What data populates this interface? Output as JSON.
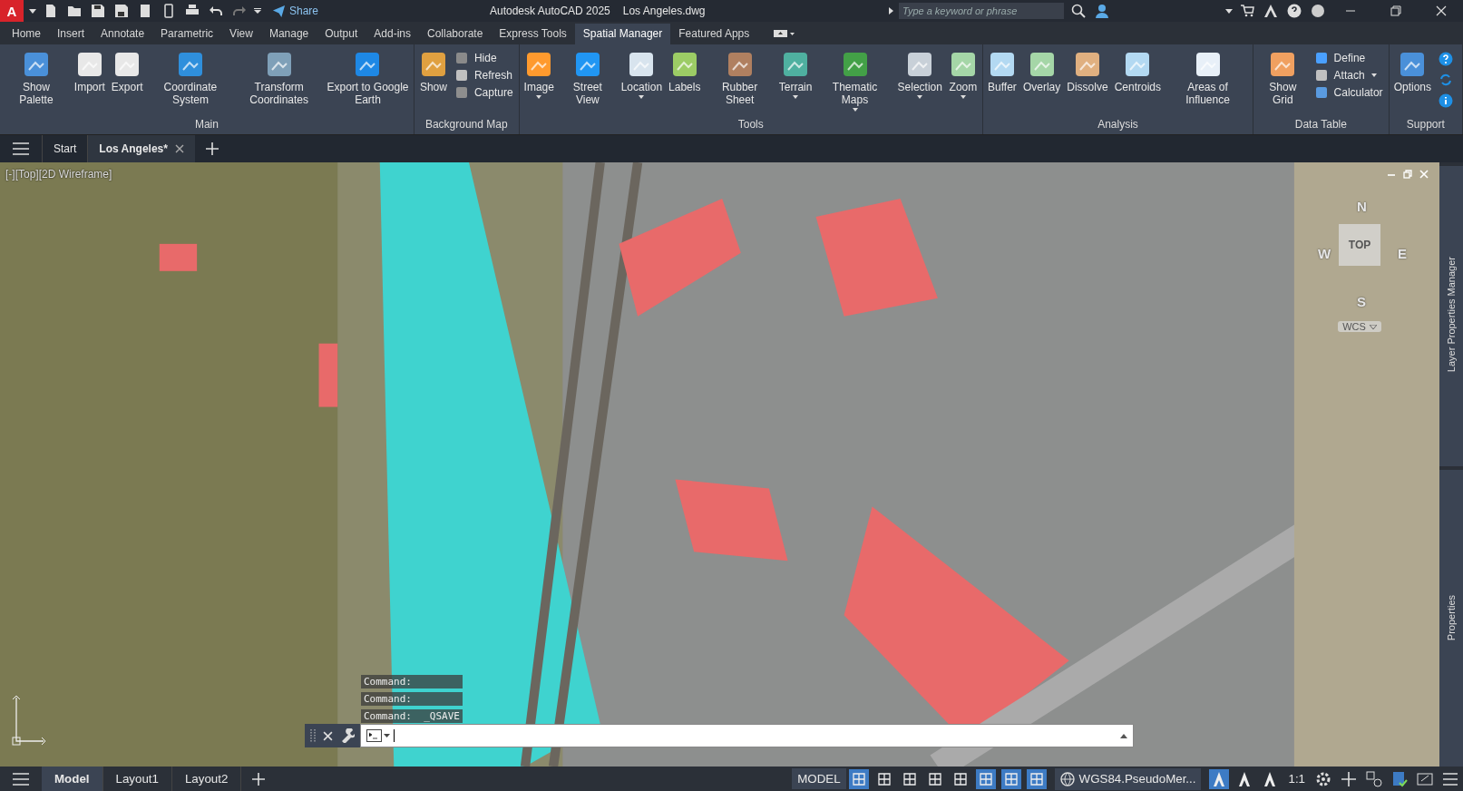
{
  "title_bar": {
    "app_button": "A",
    "share": "Share",
    "app_title": "Autodesk AutoCAD 2025",
    "file_name": "Los Angeles.dwg",
    "search": {
      "placeholder": "Type a keyword or phrase"
    }
  },
  "ribbon_tabs": [
    {
      "label": "Home",
      "selected": false
    },
    {
      "label": "Insert",
      "selected": false
    },
    {
      "label": "Annotate",
      "selected": false
    },
    {
      "label": "Parametric",
      "selected": false
    },
    {
      "label": "View",
      "selected": false
    },
    {
      "label": "Manage",
      "selected": false
    },
    {
      "label": "Output",
      "selected": false
    },
    {
      "label": "Add-ins",
      "selected": false
    },
    {
      "label": "Collaborate",
      "selected": false
    },
    {
      "label": "Express Tools",
      "selected": false
    },
    {
      "label": "Spatial Manager",
      "selected": true
    },
    {
      "label": "Featured Apps",
      "selected": false
    }
  ],
  "ribbon_panels": [
    {
      "title": "Main",
      "items": [
        {
          "kind": "large",
          "label": "Show Palette",
          "dropdown": false
        },
        {
          "kind": "large",
          "label": "Import",
          "dropdown": false
        },
        {
          "kind": "large",
          "label": "Export",
          "dropdown": false
        },
        {
          "kind": "large",
          "label": "Coordinate System",
          "dropdown": false
        },
        {
          "kind": "large",
          "label": "Transform Coordinates",
          "dropdown": false
        },
        {
          "kind": "large",
          "label": "Export to Google Earth",
          "dropdown": false
        }
      ]
    },
    {
      "title": "Background Map",
      "items": [
        {
          "kind": "large",
          "label": "Show",
          "dropdown": false
        },
        {
          "kind": "small",
          "label": "Hide",
          "dropdown": false
        },
        {
          "kind": "small",
          "label": "Refresh",
          "dropdown": false
        },
        {
          "kind": "small",
          "label": "Capture",
          "dropdown": false
        }
      ]
    },
    {
      "title": "Tools",
      "items": [
        {
          "kind": "large",
          "label": "Image",
          "dropdown": true
        },
        {
          "kind": "large",
          "label": "Street View",
          "dropdown": false
        },
        {
          "kind": "large",
          "label": "Location",
          "dropdown": true
        },
        {
          "kind": "large",
          "label": "Labels",
          "dropdown": false
        },
        {
          "kind": "large",
          "label": "Rubber Sheet",
          "dropdown": false
        },
        {
          "kind": "large",
          "label": "Terrain",
          "dropdown": true
        },
        {
          "kind": "large",
          "label": "Thematic Maps",
          "dropdown": true
        },
        {
          "kind": "large",
          "label": "Selection",
          "dropdown": true
        },
        {
          "kind": "large",
          "label": "Zoom",
          "dropdown": true
        }
      ]
    },
    {
      "title": "Analysis",
      "items": [
        {
          "kind": "large",
          "label": "Buffer",
          "dropdown": false
        },
        {
          "kind": "large",
          "label": "Overlay",
          "dropdown": false
        },
        {
          "kind": "large",
          "label": "Dissolve",
          "dropdown": false
        },
        {
          "kind": "large",
          "label": "Centroids",
          "dropdown": false
        },
        {
          "kind": "large",
          "label": "Areas of Influence",
          "dropdown": false
        }
      ]
    },
    {
      "title": "Data Table",
      "items": [
        {
          "kind": "large",
          "label": "Show Grid",
          "dropdown": false
        },
        {
          "kind": "small",
          "label": "Define",
          "dropdown": false
        },
        {
          "kind": "small",
          "label": "Attach",
          "dropdown": true
        },
        {
          "kind": "small",
          "label": "Calculator",
          "dropdown": false
        }
      ]
    },
    {
      "title": "Support",
      "items": [
        {
          "kind": "large",
          "label": "Options",
          "dropdown": false
        },
        {
          "kind": "icons"
        }
      ]
    }
  ],
  "doc_tabs": [
    {
      "label": "Start",
      "selected": false,
      "closable": false
    },
    {
      "label": "Los Angeles*",
      "selected": true,
      "closable": true
    }
  ],
  "viewport": {
    "view_label": "[-][Top][2D Wireframe]",
    "viewcube": {
      "face": "TOP",
      "north": "N",
      "south": "S",
      "east": "E",
      "west": "W",
      "ucs": "WCS"
    },
    "command_history": [
      "Command:",
      "Command:",
      "Command:  _QSAVE"
    ],
    "side_palettes": [
      "Layer Properties Manager",
      "Properties"
    ]
  },
  "layout_tabs": [
    {
      "label": "Model",
      "selected": true
    },
    {
      "label": "Layout1",
      "selected": false
    },
    {
      "label": "Layout2",
      "selected": false
    }
  ],
  "status_bar": {
    "space": "MODEL",
    "coordinate_system": "WGS84.PseudoMer...",
    "scale": "1:1",
    "toggles": [
      {
        "on": true
      },
      {
        "on": false
      },
      {
        "on": false
      },
      {
        "on": false
      },
      {
        "on": false
      },
      {
        "on": true
      },
      {
        "on": true
      },
      {
        "on": true
      }
    ],
    "annotation_toggles": [
      {
        "on": true
      },
      {
        "on": false
      },
      {
        "on": false
      }
    ]
  }
}
